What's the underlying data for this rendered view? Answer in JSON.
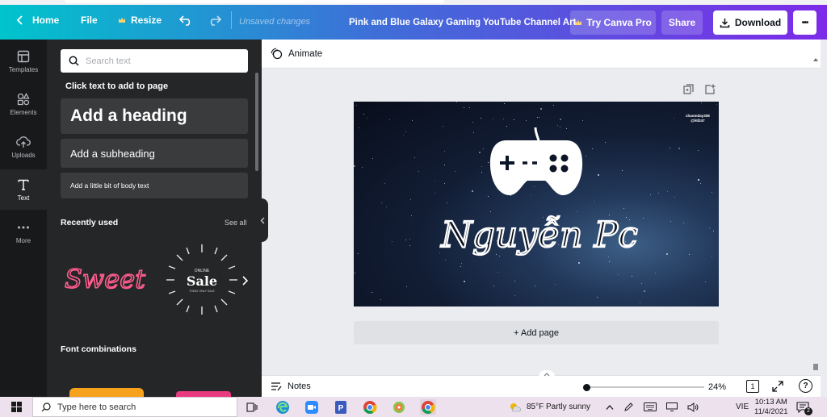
{
  "topbar": {
    "home_label": "Home",
    "file_label": "File",
    "resize_label": "Resize",
    "unsaved_text": "Unsaved changes",
    "doc_title": "Pink and Blue Galaxy Gaming YouTube Channel Art",
    "try_pro_label": "Try Canva Pro",
    "share_label": "Share",
    "download_label": "Download",
    "more_label": "•••"
  },
  "rail": {
    "items": [
      {
        "label": "Templates",
        "icon": "templates-icon"
      },
      {
        "label": "Elements",
        "icon": "elements-icon"
      },
      {
        "label": "Uploads",
        "icon": "uploads-icon"
      },
      {
        "label": "Text",
        "icon": "text-icon",
        "active": true
      },
      {
        "label": "More",
        "icon": "more-icon"
      }
    ]
  },
  "panel": {
    "search_placeholder": "Search text",
    "click_hint": "Click text to add to page",
    "add_heading": "Add a heading",
    "add_subheading": "Add a subheading",
    "add_body": "Add a little bit of body text",
    "recently_used": "Recently used",
    "see_all": "See all",
    "font_combinations": "Font combinations",
    "recent": [
      {
        "text": "Sweet",
        "color": "#ff5d8f"
      },
      {
        "top": "ONLINE",
        "main": "Sale",
        "bottom": "TODAY ONLY SALE"
      }
    ]
  },
  "editor": {
    "animate_label": "Animate",
    "add_page_label": "+ Add page",
    "notes_label": "Notes",
    "zoom": "24%",
    "page_number": "1",
    "help_label": "?"
  },
  "canvas": {
    "handle_line1": "chaomday308",
    "handle_line2": "@hd247",
    "channel_name": "Nguyễn Pc",
    "colors": {
      "sky_dark": "#080d1b",
      "sky_light": "#3d5f86",
      "controller": "#ffffff"
    }
  },
  "taskbar": {
    "search_placeholder": "Type here to search",
    "weather": "85°F  Partly sunny",
    "lang": "VIE",
    "time": "10:13 AM",
    "date": "11/4/2021",
    "notifications": "2"
  },
  "colors": {
    "grad_start": "#00c4cc",
    "grad_end": "#7d2ae8",
    "rail_bg": "#18191b",
    "panel_bg": "#252627"
  }
}
